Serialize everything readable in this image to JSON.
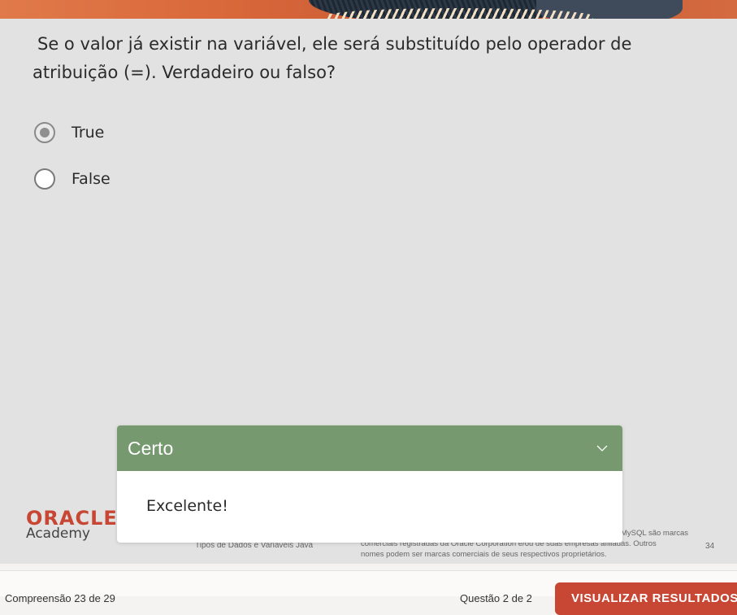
{
  "question": {
    "text": "Se o valor já existir na variável, ele será substituído pelo operador de atribuição (=). Verdadeiro ou falso?",
    "options": [
      {
        "label": "True",
        "selected": true
      },
      {
        "label": "False",
        "selected": false
      }
    ]
  },
  "feedback": {
    "title": "Certo",
    "message": "Excelente!",
    "header_color": "#76996f"
  },
  "slide_footer": {
    "logo_text": "ORACLE",
    "logo_subtext": "Academy",
    "topic": "Tipos de Dados e Variáveis Java",
    "copyright_line1": "MySQL são marcas",
    "copyright_line2": "comerciais registradas da Oracle Corporation e/ou de suas empresas afiliadas. Outros",
    "copyright_line3": "nomes podem ser marcas comerciais de seus respectivos proprietários.",
    "page_number": "34"
  },
  "bottom_bar": {
    "progress_text": "Compreensão 23 de 29",
    "question_nav_text": "Questão 2 de 2",
    "results_button_label": "VISUALIZAR RESULTADOS"
  },
  "colors": {
    "brand_red": "#c74634",
    "slide_background": "#e1e2e1"
  }
}
